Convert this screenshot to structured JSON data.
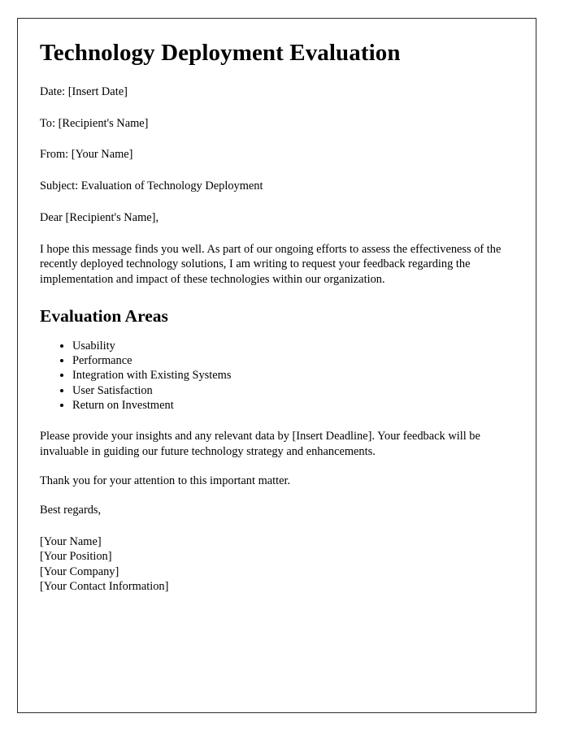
{
  "document": {
    "title": "Technology Deployment Evaluation",
    "meta_lines": [
      "Date: [Insert Date]",
      "To: [Recipient's Name]",
      "From: [Your Name]",
      "Subject: Evaluation of Technology Deployment"
    ],
    "salutation": "Dear [Recipient's Name],",
    "intro_paragraph": "I hope this message finds you well. As part of our ongoing efforts to assess the effectiveness of the recently deployed technology solutions, I am writing to request your feedback regarding the implementation and impact of these technologies within our organization.",
    "section_heading": "Evaluation Areas",
    "evaluation_areas": [
      "Usability",
      "Performance",
      "Integration with Existing Systems",
      "User Satisfaction",
      "Return on Investment"
    ],
    "request_paragraph": "Please provide your insights and any relevant data by [Insert Deadline]. Your feedback will be invaluable in guiding our future technology strategy and enhancements.",
    "thanks_paragraph": "Thank you for your attention to this important matter.",
    "signoff": "Best regards,",
    "signature_lines": [
      "[Your Name]",
      "[Your Position]",
      "[Your Company]",
      "[Your Contact Information]"
    ]
  }
}
